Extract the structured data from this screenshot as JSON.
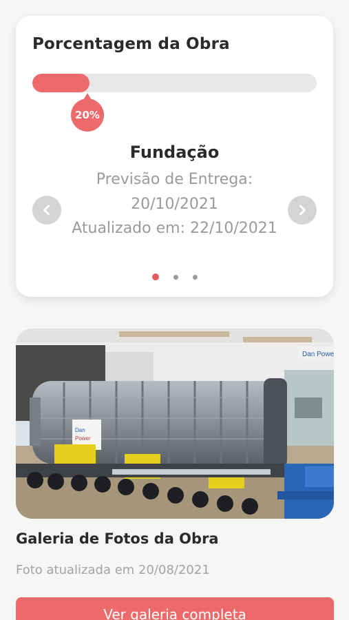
{
  "progress_card": {
    "title": "Porcentagem da Obra",
    "percent_value": 20,
    "percent_label": "20%",
    "stage": "Fundação",
    "delivery_label": "Previsão de Entrega:",
    "delivery_date": "20/10/2021",
    "updated_text": "Atualizado em: 22/10/2021",
    "prev_icon": "chevron-left-icon",
    "next_icon": "chevron-right-icon",
    "slide_count": 3,
    "active_slide": 1
  },
  "gallery": {
    "title": "Galeria de Fotos da Obra",
    "subtitle": "Foto atualizada em 20/08/2021",
    "button_label": "Ver galeria completa",
    "logo_text": "Dan Power"
  },
  "colors": {
    "accent": "#ec6a6a",
    "track": "#e8e8e8",
    "muted_text": "#9a9a9a",
    "title_text": "#2a2a2a",
    "nav_button": "#d4d4d4"
  }
}
